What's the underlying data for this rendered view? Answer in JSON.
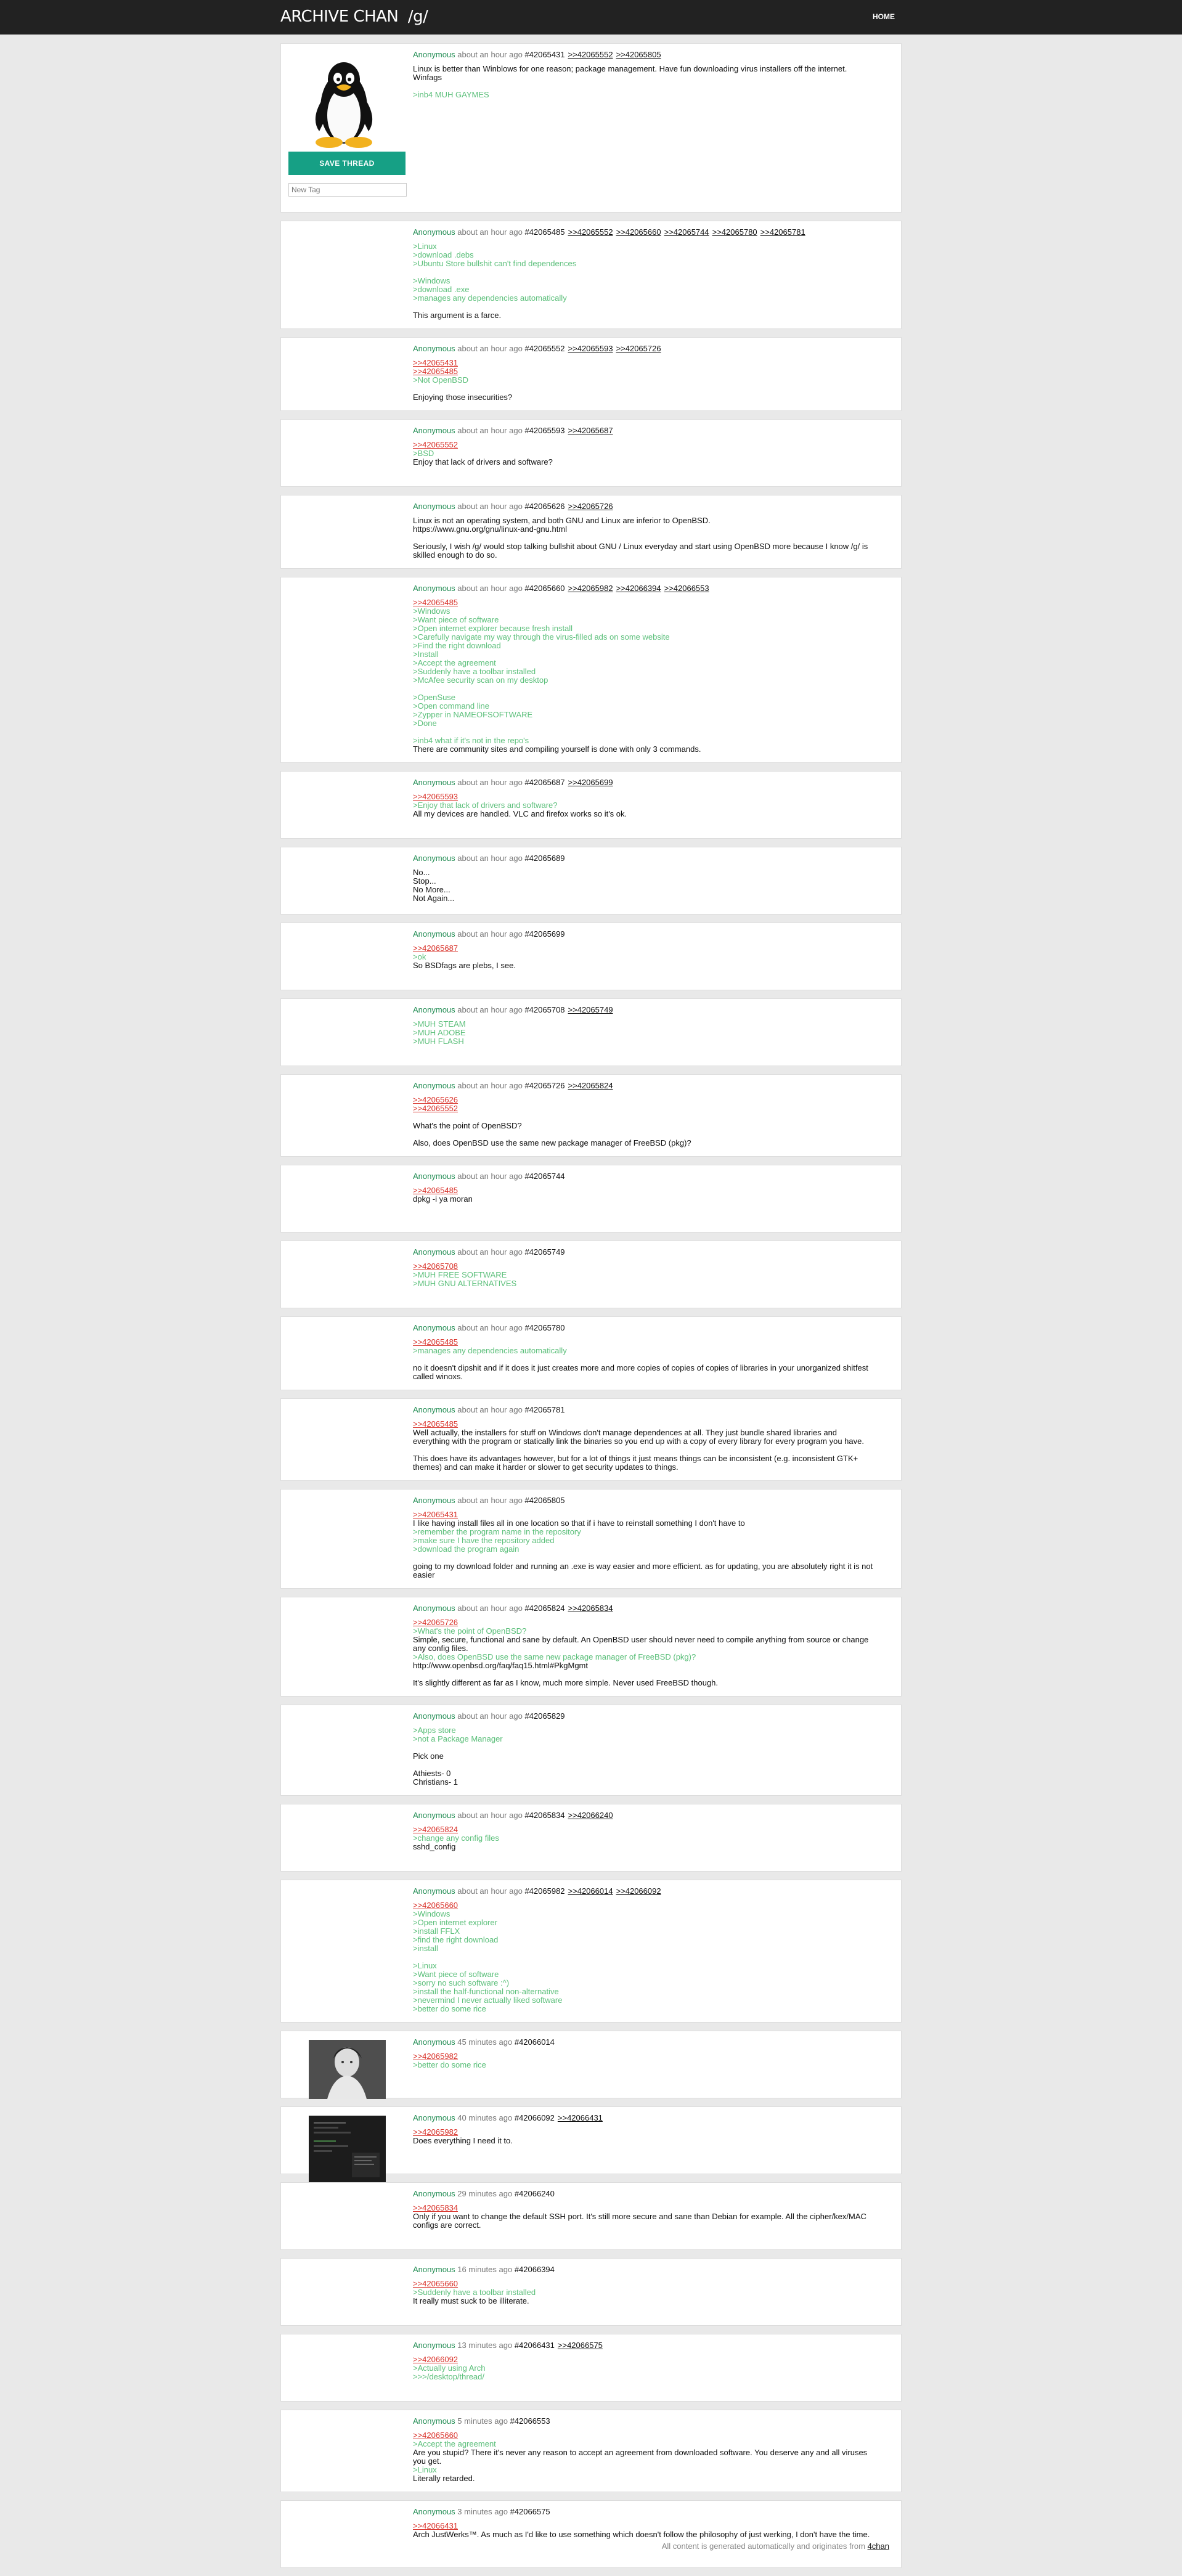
{
  "header": {
    "site": "ARCHIVE CHAN",
    "board": "/g/",
    "home": "HOME"
  },
  "op_panel": {
    "save_label": "SAVE THREAD",
    "tag_placeholder": "New Tag"
  },
  "footer": {
    "text": "All content is generated automatically and originates from ",
    "link": "4chan"
  },
  "posts": [
    {
      "author": "Anonymous",
      "time": "about an hour ago",
      "no": "#42065431",
      "replies": [
        ">>42065552",
        ">>42065805"
      ],
      "image": "linux-penguin",
      "op": true,
      "lines": [
        {
          "t": "Linux is better than Winblows for one reason; package management. Have fun downloading virus installers off the internet."
        },
        {
          "t": "Winfags"
        },
        {
          "blank": true
        },
        {
          "t": ">inb4 MUH GAYMES",
          "k": "gt"
        }
      ]
    },
    {
      "author": "Anonymous",
      "time": "about an hour ago",
      "no": "#42065485",
      "replies": [
        ">>42065552",
        ">>42065660",
        ">>42065744",
        ">>42065780",
        ">>42065781"
      ],
      "lines": [
        {
          "t": ">Linux",
          "k": "gt"
        },
        {
          "t": ">download .debs",
          "k": "gt"
        },
        {
          "t": ">Ubuntu Store bullshit can't find dependences",
          "k": "gt"
        },
        {
          "blank": true
        },
        {
          "t": ">Windows",
          "k": "gt"
        },
        {
          "t": ">download .exe",
          "k": "gt"
        },
        {
          "t": ">manages any dependencies automatically",
          "k": "gt"
        },
        {
          "blank": true
        },
        {
          "t": "This argument is a farce."
        }
      ]
    },
    {
      "author": "Anonymous",
      "time": "about an hour ago",
      "no": "#42065552",
      "replies": [
        ">>42065593",
        ">>42065726"
      ],
      "lines": [
        {
          "t": ">>42065431",
          "k": "ql"
        },
        {
          "t": ">>42065485",
          "k": "ql"
        },
        {
          "t": ">Not OpenBSD",
          "k": "gt"
        },
        {
          "blank": true
        },
        {
          "t": "Enjoying those insecurities?"
        }
      ]
    },
    {
      "author": "Anonymous",
      "time": "about an hour ago",
      "no": "#42065593",
      "replies": [
        ">>42065687"
      ],
      "lines": [
        {
          "t": ">>42065552",
          "k": "ql"
        },
        {
          "t": ">BSD",
          "k": "gt"
        },
        {
          "t": "Enjoy that lack of drivers and software?"
        }
      ]
    },
    {
      "author": "Anonymous",
      "time": "about an hour ago",
      "no": "#42065626",
      "replies": [
        ">>42065726"
      ],
      "lines": [
        {
          "t": "Linux is not an operating system, and both GNU and Linux are inferior to OpenBSD."
        },
        {
          "t": "https://www.gnu.org/gnu/linux-and-gnu.html"
        },
        {
          "blank": true
        },
        {
          "t": "Seriously, I wish /g/ would stop talking bullshit about GNU / Linux everyday and start using OpenBSD more because I know /g/ is"
        },
        {
          "t": "skilled enough to do so."
        }
      ]
    },
    {
      "author": "Anonymous",
      "time": "about an hour ago",
      "no": "#42065660",
      "replies": [
        ">>42065982",
        ">>42066394",
        ">>42066553"
      ],
      "lines": [
        {
          "t": ">>42065485",
          "k": "ql"
        },
        {
          "t": ">Windows",
          "k": "gt"
        },
        {
          "t": ">Want piece of software",
          "k": "gt"
        },
        {
          "t": ">Open internet explorer because fresh install",
          "k": "gt"
        },
        {
          "t": ">Carefully navigate my way through the virus-filled ads on some website",
          "k": "gt"
        },
        {
          "t": ">Find the right download",
          "k": "gt"
        },
        {
          "t": ">Install",
          "k": "gt"
        },
        {
          "t": ">Accept the agreement",
          "k": "gt"
        },
        {
          "t": ">Suddenly have a toolbar installed",
          "k": "gt"
        },
        {
          "t": ">McAfee security scan on my desktop",
          "k": "gt"
        },
        {
          "blank": true
        },
        {
          "t": ">OpenSuse",
          "k": "gt"
        },
        {
          "t": ">Open command line",
          "k": "gt"
        },
        {
          "t": ">Zypper in NAMEOFSOFTWARE",
          "k": "gt"
        },
        {
          "t": ">Done",
          "k": "gt"
        },
        {
          "blank": true
        },
        {
          "t": ">inb4 what if it's not in the repo's",
          "k": "gt"
        },
        {
          "t": "There are community sites and compiling yourself is done with only 3 commands."
        }
      ]
    },
    {
      "author": "Anonymous",
      "time": "about an hour ago",
      "no": "#42065687",
      "replies": [
        ">>42065699"
      ],
      "lines": [
        {
          "t": ">>42065593",
          "k": "ql"
        },
        {
          "t": ">Enjoy that lack of drivers and software?",
          "k": "gt"
        },
        {
          "t": "All my devices are handled. VLC and firefox works so it's ok."
        }
      ]
    },
    {
      "author": "Anonymous",
      "time": "about an hour ago",
      "no": "#42065689",
      "replies": [],
      "lines": [
        {
          "t": "No..."
        },
        {
          "t": "Stop..."
        },
        {
          "t": "No More..."
        },
        {
          "t": "Not Again..."
        }
      ]
    },
    {
      "author": "Anonymous",
      "time": "about an hour ago",
      "no": "#42065699",
      "replies": [],
      "lines": [
        {
          "t": ">>42065687",
          "k": "ql"
        },
        {
          "t": ">ok",
          "k": "gt"
        },
        {
          "t": "So BSDfags are plebs, I see."
        }
      ]
    },
    {
      "author": "Anonymous",
      "time": "about an hour ago",
      "no": "#42065708",
      "replies": [
        ">>42065749"
      ],
      "lines": [
        {
          "t": ">MUH STEAM",
          "k": "gt"
        },
        {
          "t": ">MUH ADOBE",
          "k": "gt"
        },
        {
          "t": ">MUH FLASH",
          "k": "gt"
        }
      ]
    },
    {
      "author": "Anonymous",
      "time": "about an hour ago",
      "no": "#42065726",
      "replies": [
        ">>42065824"
      ],
      "lines": [
        {
          "t": ">>42065626",
          "k": "ql"
        },
        {
          "t": ">>42065552",
          "k": "ql"
        },
        {
          "blank": true
        },
        {
          "t": "What's the point of OpenBSD?"
        },
        {
          "blank": true
        },
        {
          "t": "Also, does OpenBSD use the same new package manager of FreeBSD (pkg)?"
        }
      ]
    },
    {
      "author": "Anonymous",
      "time": "about an hour ago",
      "no": "#42065744",
      "replies": [],
      "lines": [
        {
          "t": ">>42065485",
          "k": "ql"
        },
        {
          "t": "dpkg -i ya moran"
        }
      ]
    },
    {
      "author": "Anonymous",
      "time": "about an hour ago",
      "no": "#42065749",
      "replies": [],
      "lines": [
        {
          "t": ">>42065708",
          "k": "ql"
        },
        {
          "t": ">MUH FREE SOFTWARE",
          "k": "gt"
        },
        {
          "t": ">MUH GNU ALTERNATIVES",
          "k": "gt"
        }
      ]
    },
    {
      "author": "Anonymous",
      "time": "about an hour ago",
      "no": "#42065780",
      "replies": [],
      "lines": [
        {
          "t": ">>42065485",
          "k": "ql"
        },
        {
          "t": ">manages any dependencies automatically",
          "k": "gt"
        },
        {
          "blank": true
        },
        {
          "t": "no it doesn't dipshit and if it does it just creates more and more copies of copies of copies of libraries in your unorganized shitfest"
        },
        {
          "t": "called winoxs."
        }
      ]
    },
    {
      "author": "Anonymous",
      "time": "about an hour ago",
      "no": "#42065781",
      "replies": [],
      "lines": [
        {
          "t": ">>42065485",
          "k": "ql"
        },
        {
          "t": "Well actually, the installers for stuff on Windows don't manage dependences at all. They just bundle shared libraries and"
        },
        {
          "t": "everything with the program or statically link the binaries so you end up with a copy of every library for every program you have."
        },
        {
          "blank": true
        },
        {
          "t": "This does have its advantages however, but for a lot of things it just means things can be inconsistent (e.g. inconsistent GTK+"
        },
        {
          "t": "themes) and can make it harder or slower to get security updates to things."
        }
      ]
    },
    {
      "author": "Anonymous",
      "time": "about an hour ago",
      "no": "#42065805",
      "replies": [],
      "lines": [
        {
          "t": ">>42065431",
          "k": "ql"
        },
        {
          "t": "I like having install files all in one location so that if i have to reinstall something I don't have to"
        },
        {
          "t": ">remember the program name in the repository",
          "k": "gt"
        },
        {
          "t": ">make sure I have the repository added",
          "k": "gt"
        },
        {
          "t": ">download the program again",
          "k": "gt"
        },
        {
          "blank": true
        },
        {
          "t": "going to my download folder and running an .exe is way easier and more efficient. as for updating, you are absolutely right it is not"
        },
        {
          "t": "easier"
        }
      ]
    },
    {
      "author": "Anonymous",
      "time": "about an hour ago",
      "no": "#42065824",
      "replies": [
        ">>42065834"
      ],
      "lines": [
        {
          "t": ">>42065726",
          "k": "ql"
        },
        {
          "t": ">What's the point of OpenBSD?",
          "k": "gt"
        },
        {
          "t": "Simple, secure, functional and sane by default. An OpenBSD user should never need to compile anything from source or change"
        },
        {
          "t": "any config files."
        },
        {
          "t": ">Also, does OpenBSD use the same new package manager of FreeBSD (pkg)?",
          "k": "gt"
        },
        {
          "t": "http://www.openbsd.org/faq/faq15.html#PkgMgmt"
        },
        {
          "blank": true
        },
        {
          "t": "It's slightly different as far as I know, much more simple. Never used FreeBSD though."
        }
      ]
    },
    {
      "author": "Anonymous",
      "time": "about an hour ago",
      "no": "#42065829",
      "replies": [],
      "lines": [
        {
          "t": ">Apps store",
          "k": "gt"
        },
        {
          "t": ">not a Package Manager",
          "k": "gt"
        },
        {
          "blank": true
        },
        {
          "t": "Pick one"
        },
        {
          "blank": true
        },
        {
          "t": "Athiests- 0"
        },
        {
          "t": "Christians- 1"
        }
      ]
    },
    {
      "author": "Anonymous",
      "time": "about an hour ago",
      "no": "#42065834",
      "replies": [
        ">>42066240"
      ],
      "lines": [
        {
          "t": ">>42065824",
          "k": "ql"
        },
        {
          "t": ">change any config files",
          "k": "gt"
        },
        {
          "t": "sshd_config"
        }
      ]
    },
    {
      "author": "Anonymous",
      "time": "about an hour ago",
      "no": "#42065982",
      "replies": [
        ">>42066014",
        ">>42066092"
      ],
      "lines": [
        {
          "t": ">>42065660",
          "k": "ql"
        },
        {
          "t": ">Windows",
          "k": "gt"
        },
        {
          "t": ">Open internet explorer",
          "k": "gt"
        },
        {
          "t": ">install FFLX",
          "k": "gt"
        },
        {
          "t": ">find the right download",
          "k": "gt"
        },
        {
          "t": ">install",
          "k": "gt"
        },
        {
          "blank": true
        },
        {
          "t": ">Linux",
          "k": "gt"
        },
        {
          "t": ">Want piece of software",
          "k": "gt"
        },
        {
          "t": ">sorry no such software :^)",
          "k": "gt"
        },
        {
          "t": ">install the half-functional non-alternative",
          "k": "gt"
        },
        {
          "t": ">nevermind I never actually liked software",
          "k": "gt"
        },
        {
          "t": ">better do some rice",
          "k": "gt"
        }
      ]
    },
    {
      "author": "Anonymous",
      "time": "45 minutes ago",
      "no": "#42066014",
      "replies": [],
      "image": "girl-photo",
      "lines": [
        {
          "t": ">>42065982",
          "k": "ql"
        },
        {
          "t": ">better do some rice",
          "k": "gt"
        }
      ]
    },
    {
      "author": "Anonymous",
      "time": "40 minutes ago",
      "no": "#42066092",
      "replies": [
        ">>42066431"
      ],
      "image": "terminal-screenshot",
      "lines": [
        {
          "t": ">>42065982",
          "k": "ql"
        },
        {
          "t": "Does everything I need it to."
        }
      ]
    },
    {
      "author": "Anonymous",
      "time": "29 minutes ago",
      "no": "#42066240",
      "replies": [],
      "lines": [
        {
          "t": ">>42065834",
          "k": "ql"
        },
        {
          "t": "Only if you want to change the default SSH port. It's still more secure and sane than Debian for example. All the cipher/kex/MAC"
        },
        {
          "t": "configs are correct."
        }
      ]
    },
    {
      "author": "Anonymous",
      "time": "16 minutes ago",
      "no": "#42066394",
      "replies": [],
      "lines": [
        {
          "t": ">>42065660",
          "k": "ql"
        },
        {
          "t": ">Suddenly have a toolbar installed",
          "k": "gt"
        },
        {
          "t": "It really must suck to be illiterate."
        }
      ]
    },
    {
      "author": "Anonymous",
      "time": "13 minutes ago",
      "no": "#42066431",
      "replies": [
        ">>42066575"
      ],
      "lines": [
        {
          "t": ">>42066092",
          "k": "ql"
        },
        {
          "t": ">Actually using Arch",
          "k": "gt"
        },
        {
          "t": ">>>/desktop/thread/",
          "k": "gt"
        }
      ]
    },
    {
      "author": "Anonymous",
      "time": "5 minutes ago",
      "no": "#42066553",
      "replies": [],
      "lines": [
        {
          "t": ">>42065660",
          "k": "ql"
        },
        {
          "t": ">Accept the agreement",
          "k": "gt"
        },
        {
          "t": "Are you stupid? There it's never any reason to accept an agreement from downloaded software. You deserve any and all viruses"
        },
        {
          "t": "you get."
        },
        {
          "t": ">Linux",
          "k": "gt"
        },
        {
          "t": "Literally retarded."
        }
      ]
    },
    {
      "author": "Anonymous",
      "time": "3 minutes ago",
      "no": "#42066575",
      "replies": [],
      "lines": [
        {
          "t": ">>42066431",
          "k": "ql"
        },
        {
          "t": "Arch JustWerks™. As much as I'd like to use something which doesn't follow the philosophy of just werking, I don't have the time."
        }
      ]
    }
  ]
}
